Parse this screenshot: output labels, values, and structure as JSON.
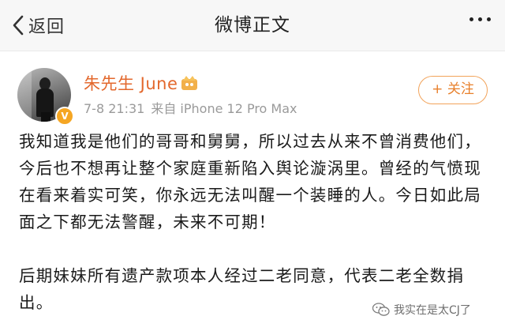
{
  "navbar": {
    "back_label": "返回",
    "title": "微博正文"
  },
  "post": {
    "username": "朱先生 June",
    "time": "7-8 21:31",
    "source": "来自 iPhone 12 Pro Max",
    "follow_label": "+ 关注",
    "verified_badge": "V",
    "paragraph1": "我知道我是他们的哥哥和舅舅，所以过去从来不曾消费他们，今后也不想再让整个家庭重新陷入舆论漩涡里。曾经的气愤现在看来着实可笑，你永远无法叫醒一个装睡的人。今日如此局面之下都无法警醒，未来不可期！",
    "paragraph2": "后期妹妹所有遗产款项本人经过二老同意，代表二老全数捐出。"
  },
  "watermark": {
    "text": "我实在是太CJ了"
  },
  "colors": {
    "username": "#e3682d",
    "follow": "#e8802c",
    "meta": "#9a9a9a",
    "navbar_bg": "#f7f7f7",
    "verified": "#f5a623"
  },
  "icons": {
    "back": "chevron-left-icon",
    "more": "more-dots-icon",
    "vip": "vip-crown-icon",
    "watermark": "wechat-icon"
  }
}
